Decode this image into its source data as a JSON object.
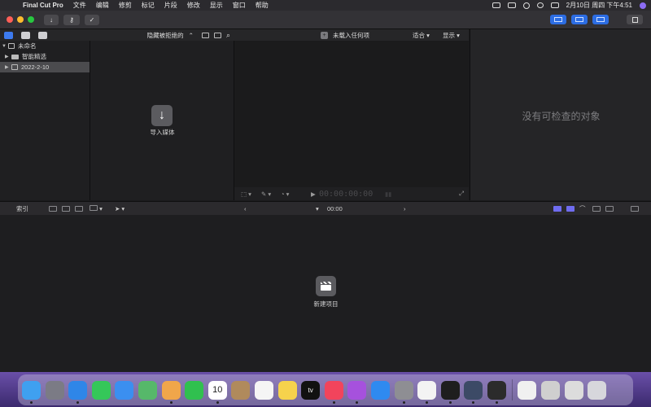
{
  "menubar": {
    "apple_icon": "apple-logo-icon",
    "items": [
      "Final Cut Pro",
      "文件",
      "编辑",
      "修剪",
      "标记",
      "片段",
      "修改",
      "显示",
      "窗口",
      "帮助"
    ],
    "clock": "2月10日 周四 下午4:51"
  },
  "toolbar": {
    "traffic_colors": [
      "#ff5f57",
      "#febc2e",
      "#28c840"
    ],
    "import_icon": "download-arrow-icon",
    "key_icon": "key-icon",
    "check_icon": "checkmark-icon"
  },
  "libraries": {
    "items": [
      {
        "label": "未命名",
        "icon": "library-icon",
        "expanded": true
      },
      {
        "label": "智能精选",
        "icon": "folder-icon"
      },
      {
        "label": "2022-2-10",
        "icon": "event-icon",
        "selected": true
      }
    ]
  },
  "browser": {
    "filter_label": "隐藏被拒绝的",
    "import_label": "导入媒体"
  },
  "viewer": {
    "title": "未载入任何项",
    "fit_label": "适合",
    "view_label": "显示",
    "timecode": "00:00:00:00"
  },
  "inspector": {
    "empty_label": "没有可检查的对象"
  },
  "timeline": {
    "index_label": "索引",
    "timecode": "00:00",
    "new_project_label": "新建项目"
  },
  "dock": {
    "apps": [
      {
        "name": "finder",
        "color": "#3fa0f0"
      },
      {
        "name": "launchpad",
        "color": "#7b7b85"
      },
      {
        "name": "safari",
        "color": "#2f86e8"
      },
      {
        "name": "messages",
        "color": "#35c759"
      },
      {
        "name": "mail",
        "color": "#3b8ff0"
      },
      {
        "name": "maps",
        "color": "#56b86a"
      },
      {
        "name": "photos",
        "color": "#f0a64a"
      },
      {
        "name": "facetime",
        "color": "#30c04f"
      },
      {
        "name": "calendar",
        "color": "#ffffff",
        "label": "10"
      },
      {
        "name": "contacts",
        "color": "#b08a5c"
      },
      {
        "name": "reminders",
        "color": "#f5f5f5"
      },
      {
        "name": "notes",
        "color": "#f6d24c"
      },
      {
        "name": "tv",
        "color": "#111111",
        "label": "tv"
      },
      {
        "name": "music",
        "color": "#f2445c"
      },
      {
        "name": "podcasts",
        "color": "#a651dd"
      },
      {
        "name": "app-store",
        "color": "#2f8af0"
      },
      {
        "name": "system-preferences",
        "color": "#8e8e93"
      },
      {
        "name": "qq",
        "color": "#f3f3f3"
      },
      {
        "name": "terminal",
        "color": "#1e1e1e"
      },
      {
        "name": "quicktime",
        "color": "#3c4a66"
      },
      {
        "name": "final-cut-pro",
        "color": "#2b2b2b"
      },
      {
        "name": "document",
        "color": "#f0f0f0"
      },
      {
        "name": "downloads",
        "color": "#cfcfcf"
      },
      {
        "name": "keyboard-viewer",
        "color": "#dcdcdc"
      },
      {
        "name": "trash",
        "color": "#d7d7dc"
      }
    ]
  }
}
